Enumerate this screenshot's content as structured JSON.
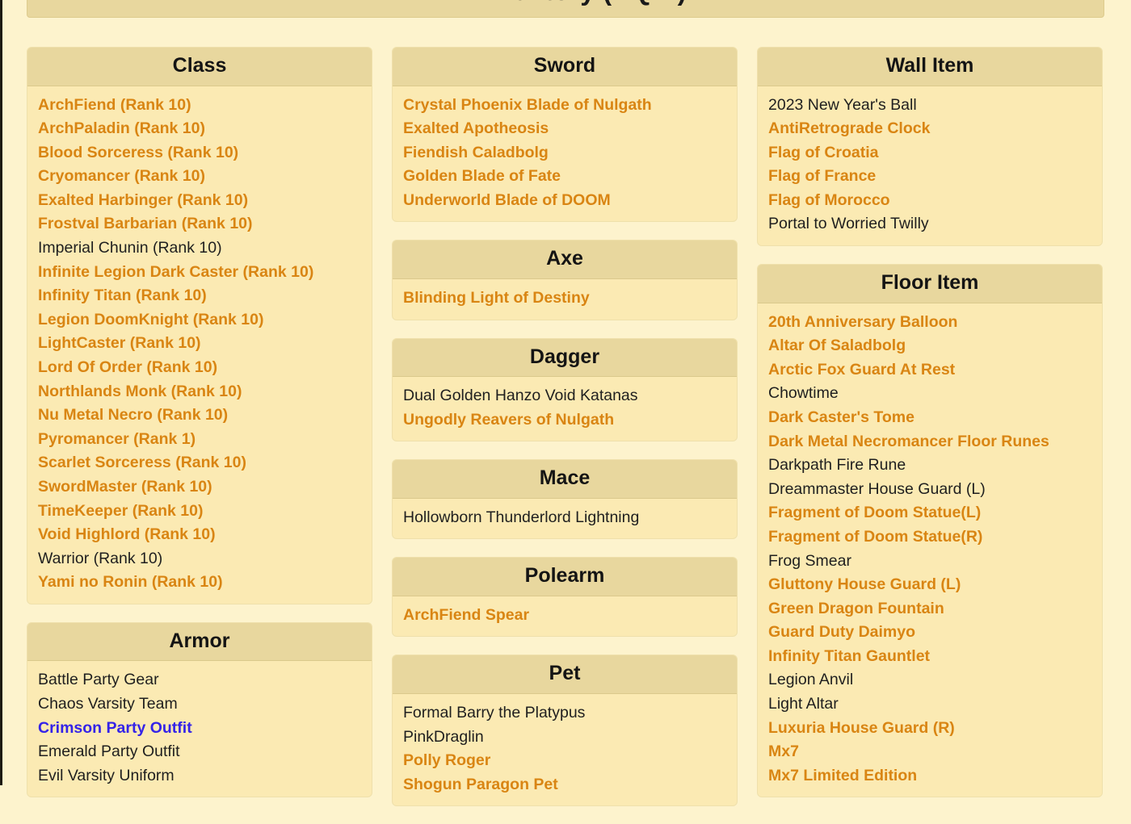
{
  "page": {
    "title_icon": "inventory-icon",
    "title": "Inventory (AQW)",
    "accent_link_color": "#d98513",
    "visited_link_color": "#3423e8",
    "plain_text_color": "#1f1f1f",
    "card_header_bg": "#e8d79e",
    "card_body_bg": "#fbeab3",
    "page_bg": "#fdf3cd"
  },
  "columns": [
    {
      "id": "column-left",
      "cards": [
        {
          "id": "card-class",
          "title": "Class",
          "items": [
            {
              "label": "ArchFiend (Rank 10)",
              "style": "link"
            },
            {
              "label": "ArchPaladin (Rank 10)",
              "style": "link"
            },
            {
              "label": "Blood Sorceress (Rank 10)",
              "style": "link"
            },
            {
              "label": "Cryomancer (Rank 10)",
              "style": "link"
            },
            {
              "label": "Exalted Harbinger (Rank 10)",
              "style": "link"
            },
            {
              "label": "Frostval Barbarian (Rank 10)",
              "style": "link"
            },
            {
              "label": "Imperial Chunin (Rank 10)",
              "style": "plain"
            },
            {
              "label": "Infinite Legion Dark Caster (Rank 10)",
              "style": "link"
            },
            {
              "label": "Infinity Titan (Rank 10)",
              "style": "link"
            },
            {
              "label": "Legion DoomKnight (Rank 10)",
              "style": "link"
            },
            {
              "label": "LightCaster (Rank 10)",
              "style": "link"
            },
            {
              "label": "Lord Of Order (Rank 10)",
              "style": "link"
            },
            {
              "label": "Northlands Monk (Rank 10)",
              "style": "link"
            },
            {
              "label": "Nu Metal Necro (Rank 10)",
              "style": "link"
            },
            {
              "label": "Pyromancer (Rank 1)",
              "style": "link"
            },
            {
              "label": "Scarlet Sorceress (Rank 10)",
              "style": "link"
            },
            {
              "label": "SwordMaster (Rank 10)",
              "style": "link"
            },
            {
              "label": "TimeKeeper (Rank 10)",
              "style": "link"
            },
            {
              "label": "Void Highlord (Rank 10)",
              "style": "link"
            },
            {
              "label": "Warrior (Rank 10)",
              "style": "plain"
            },
            {
              "label": "Yami no Ronin (Rank 10)",
              "style": "link"
            }
          ]
        },
        {
          "id": "card-armor",
          "title": "Armor",
          "items": [
            {
              "label": "Battle Party Gear",
              "style": "plain"
            },
            {
              "label": "Chaos Varsity Team",
              "style": "plain"
            },
            {
              "label": "Crimson Party Outfit",
              "style": "visited"
            },
            {
              "label": "Emerald Party Outfit",
              "style": "plain"
            },
            {
              "label": "Evil Varsity Uniform",
              "style": "plain"
            }
          ]
        }
      ]
    },
    {
      "id": "column-middle",
      "cards": [
        {
          "id": "card-sword",
          "title": "Sword",
          "items": [
            {
              "label": "Crystal Phoenix Blade of Nulgath",
              "style": "link"
            },
            {
              "label": "Exalted Apotheosis",
              "style": "link"
            },
            {
              "label": "Fiendish Caladbolg",
              "style": "link"
            },
            {
              "label": "Golden Blade of Fate",
              "style": "link"
            },
            {
              "label": "Underworld Blade of DOOM",
              "style": "link"
            }
          ]
        },
        {
          "id": "card-axe",
          "title": "Axe",
          "items": [
            {
              "label": "Blinding Light of Destiny",
              "style": "link"
            }
          ]
        },
        {
          "id": "card-dagger",
          "title": "Dagger",
          "items": [
            {
              "label": "Dual Golden Hanzo Void Katanas",
              "style": "plain"
            },
            {
              "label": "Ungodly Reavers of Nulgath",
              "style": "link"
            }
          ]
        },
        {
          "id": "card-mace",
          "title": "Mace",
          "items": [
            {
              "label": "Hollowborn Thunderlord Lightning",
              "style": "plain"
            }
          ]
        },
        {
          "id": "card-polearm",
          "title": "Polearm",
          "items": [
            {
              "label": "ArchFiend Spear",
              "style": "link"
            }
          ]
        },
        {
          "id": "card-pet",
          "title": "Pet",
          "items": [
            {
              "label": "Formal Barry the Platypus",
              "style": "plain"
            },
            {
              "label": "PinkDraglin",
              "style": "plain"
            },
            {
              "label": "Polly Roger",
              "style": "link"
            },
            {
              "label": "Shogun Paragon Pet",
              "style": "link"
            }
          ]
        }
      ]
    },
    {
      "id": "column-right",
      "cards": [
        {
          "id": "card-wall-item",
          "title": "Wall Item",
          "items": [
            {
              "label": "2023 New Year's Ball",
              "style": "plain"
            },
            {
              "label": "AntiRetrograde Clock",
              "style": "link"
            },
            {
              "label": "Flag of Croatia",
              "style": "link"
            },
            {
              "label": "Flag of France",
              "style": "link"
            },
            {
              "label": "Flag of Morocco",
              "style": "link"
            },
            {
              "label": "Portal to Worried Twilly",
              "style": "plain"
            }
          ]
        },
        {
          "id": "card-floor-item",
          "title": "Floor Item",
          "items": [
            {
              "label": "20th Anniversary Balloon",
              "style": "link"
            },
            {
              "label": "Altar Of Saladbolg",
              "style": "link"
            },
            {
              "label": "Arctic Fox Guard At Rest",
              "style": "link"
            },
            {
              "label": "Chowtime",
              "style": "plain"
            },
            {
              "label": "Dark Caster's Tome",
              "style": "link"
            },
            {
              "label": "Dark Metal Necromancer Floor Runes",
              "style": "link"
            },
            {
              "label": "Darkpath Fire Rune",
              "style": "plain"
            },
            {
              "label": "Dreammaster House Guard (L)",
              "style": "plain"
            },
            {
              "label": "Fragment of Doom Statue(L)",
              "style": "link"
            },
            {
              "label": "Fragment of Doom Statue(R)",
              "style": "link"
            },
            {
              "label": "Frog Smear",
              "style": "plain"
            },
            {
              "label": "Gluttony House Guard (L)",
              "style": "link"
            },
            {
              "label": "Green Dragon Fountain",
              "style": "link"
            },
            {
              "label": "Guard Duty Daimyo",
              "style": "link"
            },
            {
              "label": "Infinity Titan Gauntlet",
              "style": "link"
            },
            {
              "label": "Legion Anvil",
              "style": "plain"
            },
            {
              "label": "Light Altar",
              "style": "plain"
            },
            {
              "label": "Luxuria House Guard (R)",
              "style": "link"
            },
            {
              "label": "Mx7",
              "style": "link"
            },
            {
              "label": "Mx7 Limited Edition",
              "style": "link"
            }
          ]
        }
      ]
    }
  ]
}
